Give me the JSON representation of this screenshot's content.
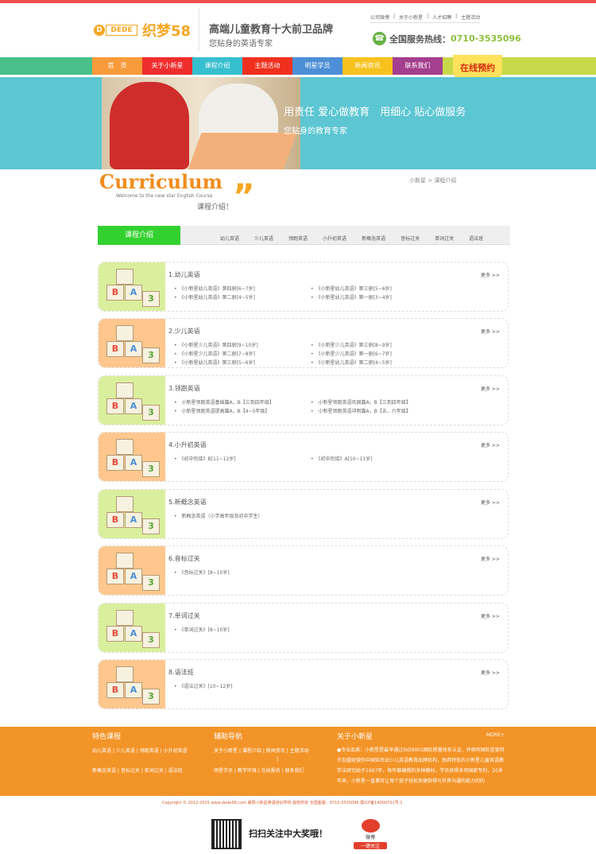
{
  "logo": {
    "d": "D",
    "dede": "DEDE",
    "zm": "织梦58"
  },
  "brand": {
    "slogan": "高端儿童教育十大前卫品牌",
    "subtitle": "您贴身的英语专家"
  },
  "toplinks": [
    "公司微博",
    "|",
    "关于小新星",
    "|",
    "人才招聘",
    "|",
    "主题活动"
  ],
  "phone": {
    "label": "全国服务热线：",
    "number": "0710-3535096"
  },
  "nav": [
    {
      "label": "首　页",
      "color": "#f79a3a"
    },
    {
      "label": "关于小新星",
      "color": "#ef2d2d"
    },
    {
      "label": "课程介绍",
      "color": "#36bfcf"
    },
    {
      "label": "主题活动",
      "color": "#f0301e"
    },
    {
      "label": "明星学员",
      "color": "#4c8fd6"
    },
    {
      "label": "新闻资讯",
      "color": "#f7c21e"
    },
    {
      "label": "联系我们",
      "color": "#a43e8e"
    }
  ],
  "cta": {
    "label": "在线预约"
  },
  "banner": {
    "line1": "用责任 爱心做教育　用细心 贴心做服务",
    "line2": "您贴身的教育专家"
  },
  "breadcrumb": {
    "home": "小新星",
    "sep": ">",
    "current": "课程介绍"
  },
  "page": {
    "title": "Curriculum",
    "subtitle": "Welcome to the new star English Course",
    "cn": "课程介绍！"
  },
  "tabs": {
    "active": "课程介绍",
    "links": [
      "幼儿英语",
      "少儿英语",
      "领跑英语",
      "小升初英语",
      "新概念英语",
      "音标过关",
      "单词过关",
      "语法班"
    ]
  },
  "categories": [
    {
      "title": "1.幼儿英语",
      "theme": "green",
      "courses": [
        "《小新星幼儿英语》第四册[6~7岁]",
        "《小新星幼儿英语》第三册[5~6岁]",
        "《小新星幼儿英语》第二册[4~5岁]",
        "《小新星幼儿英语》第一册[3~4岁]"
      ]
    },
    {
      "title": "2.少儿英语",
      "theme": "orange",
      "courses": [
        "《小新星少儿英语》第四册[9~10岁]",
        "《小新星少儿英语》第三册[8~9岁]",
        "《小新星少儿英语》第二册[7~8岁]",
        "《小新星少儿英语》第一册[6~7岁]",
        "《小新星幼儿英语》第三册[5~6岁]",
        "《小新星幼儿英语》第二册[4~5岁]"
      ]
    },
    {
      "title": "3.领跑英语",
      "theme": "green",
      "courses": [
        "小新星领跑英语基础篇A，B【三到四年级】",
        "小新星领跑英语巩固篇A，B【三到四年级】",
        "小新星领跑英语提高篇A，B【4~5年级】",
        "小新星领跑英语冲刺篇A，B【五，六年级】"
      ]
    },
    {
      "title": "4.小升初英语",
      "theme": "orange",
      "courses": [
        "《初中衔接》B[11~12岁]",
        "《初中衔接》A[10~11岁]"
      ]
    },
    {
      "title": "5.新概念英语",
      "theme": "green",
      "courses": [
        "新概念英语（小学高年级及初中学生）"
      ]
    },
    {
      "title": "6.音标过关",
      "theme": "orange",
      "courses": [
        "《音标过关》[8~10岁]"
      ]
    },
    {
      "title": "7.单词过关",
      "theme": "green",
      "courses": [
        "《单词过关》[8~10岁]"
      ]
    },
    {
      "title": "8.语法班",
      "theme": "orange",
      "courses": [
        "《语法过关》[10~12岁]"
      ]
    }
  ],
  "more_label": "更多 >>",
  "footer": {
    "col1": {
      "title": "特色课程",
      "row1": [
        "幼儿英语",
        "|",
        "少儿英语",
        "|",
        "领跑英语",
        "|",
        "小升初英语"
      ],
      "row2": [
        "新概念英语",
        "|",
        "音标过关",
        "|",
        "单词过关",
        "|",
        "语法班"
      ]
    },
    "col2": {
      "title": "辅助导航",
      "row1": [
        "关于小新星",
        "|",
        "课程介绍",
        "|",
        "新闻资讯",
        "|",
        "主题活动"
      ],
      "sep": "|",
      "row2": [
        "明星学员",
        "|",
        "教学环境",
        "|",
        "在线报名",
        "|",
        "联系我们"
      ]
    },
    "col3": {
      "title": "关于小新星",
      "more": "MORE+",
      "text": "●专业品质：小新星是最早通过ISO9001国际质量体系认证、并拥有国际连锁特许加盟经营的中国知名幼少儿英语教育品牌机构，独具特色的小新星儿童英语教学法研究始于1997年，每年都编撰的多种教材，学员获得多项国家专利，20多年来，小新星一直秉持让每个孩子轻松快捷获得与世界沟通的能力的的"
    }
  },
  "copyright": "Copyright © 2012-2015 www.dede58.com 襄阳小新星英语培训学校 版权所有 全国客服：0710-3535096 鄂ICP备14000731号-1",
  "scan": "扫扫关注中大奖哦！",
  "weibo": {
    "word": "微博",
    "btn": "一键关注"
  }
}
